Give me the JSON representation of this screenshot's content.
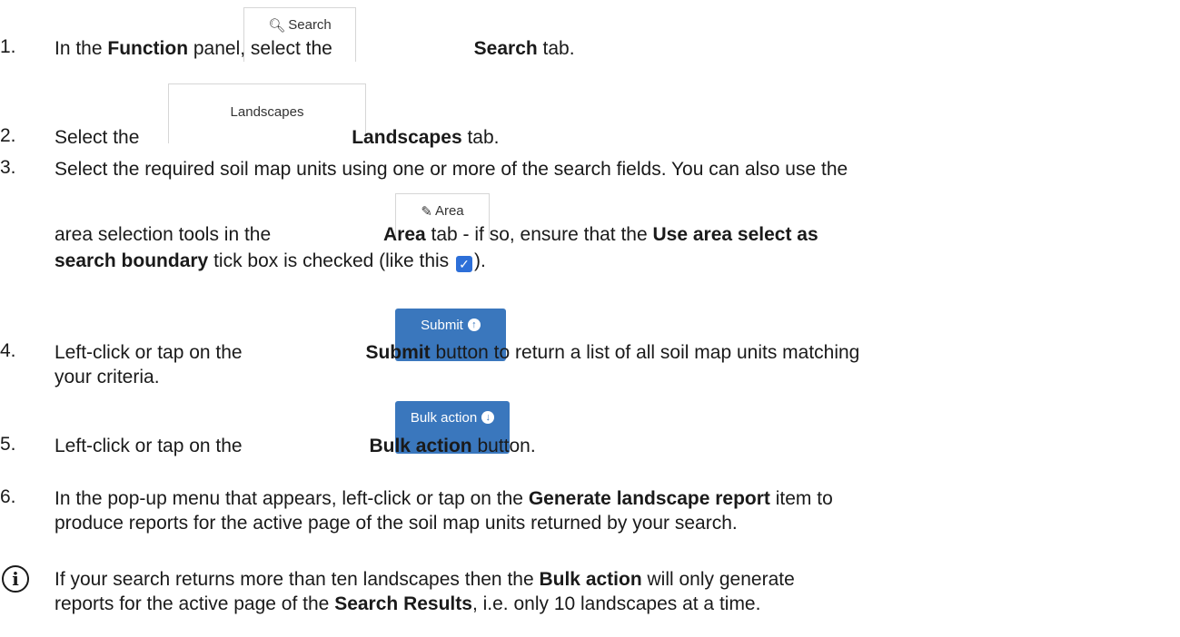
{
  "steps": [
    {
      "num": "1.",
      "pre": "In the ",
      "b1": "Function",
      "mid": " panel, select the ",
      "b2": "Search",
      "post": " tab.",
      "tab_label": "Search",
      "tab_icon": "search-icon"
    },
    {
      "num": "2.",
      "pre": "Select the ",
      "b1": "Landscapes",
      "post": " tab.",
      "tab_label": "Landscapes"
    },
    {
      "num": "3.",
      "line1": "Select the required soil map units using one or more of the search fields. You can also use the",
      "pre": "area selection tools in the ",
      "b1": "Area",
      "mid": " tab - if so, ensure that the ",
      "b2": "Use area select as",
      "b3": "search boundary",
      "post": " tick box is checked (like this ",
      "end": ").",
      "tab_label": "Area",
      "tab_icon": "edit-icon"
    },
    {
      "num": "4.",
      "pre": "Left-click or tap on the ",
      "b1": "Submit",
      "post": " button to return a list of all soil map units matching",
      "line2": "your criteria.",
      "btn_label": "Submit",
      "btn_icon": "arrow-up-circle-icon"
    },
    {
      "num": "5.",
      "pre": "Left-click or tap on the ",
      "b1": "Bulk action",
      "post": " button.",
      "btn_label": "Bulk action",
      "btn_icon": "arrow-down-circle-icon"
    },
    {
      "num": "6.",
      "pre": "In the pop-up menu that appears, left-click or tap on the ",
      "b1": "Generate landscape report",
      "post": " item to",
      "line2": "produce reports for the active page of the soil map units returned by your search."
    }
  ],
  "note": {
    "pre": "If your search returns more than ten landscapes then the ",
    "b1": "Bulk action",
    "post": " will only generate",
    "pre2": "reports for the active page of the ",
    "b2": "Search Results",
    "post2": ", i.e. only 10 landscapes at a time."
  },
  "colors": {
    "button": "#3a77bd",
    "tab_border": "#d6d6d6",
    "checkbox": "#2d6fd8"
  }
}
